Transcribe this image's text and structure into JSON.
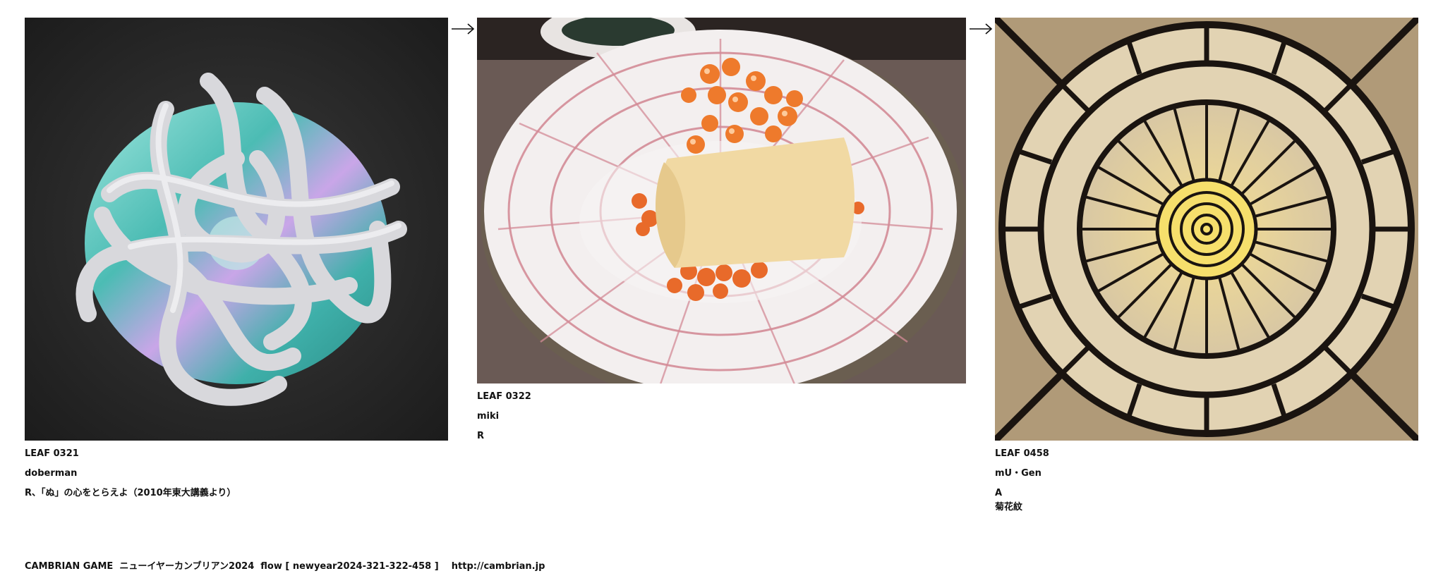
{
  "leaves": [
    {
      "id": "LEAF 0321",
      "author": "doberman",
      "comment": "R、「ぬ」の心をとらえよ（2010年東大講義より）",
      "image_desc": "white-tube-tangle-on-cd"
    },
    {
      "id": "LEAF 0322",
      "author": "miki",
      "comment": "R",
      "image_desc": "tamagoyaki-with-ikura-on-plate"
    },
    {
      "id": "LEAF 0458",
      "author": "mU・Gen",
      "comment": "A",
      "comment2": "菊花紋",
      "image_desc": "labyrinth-sun-pattern"
    }
  ],
  "arrows": [
    "right-arrow-icon",
    "right-arrow-icon"
  ],
  "footer": {
    "text": "CAMBRIAN GAME  ニューイヤーカンブリアン2024  flow [ newyear2024-321-322-458 ]    http://cambrian.jp"
  }
}
